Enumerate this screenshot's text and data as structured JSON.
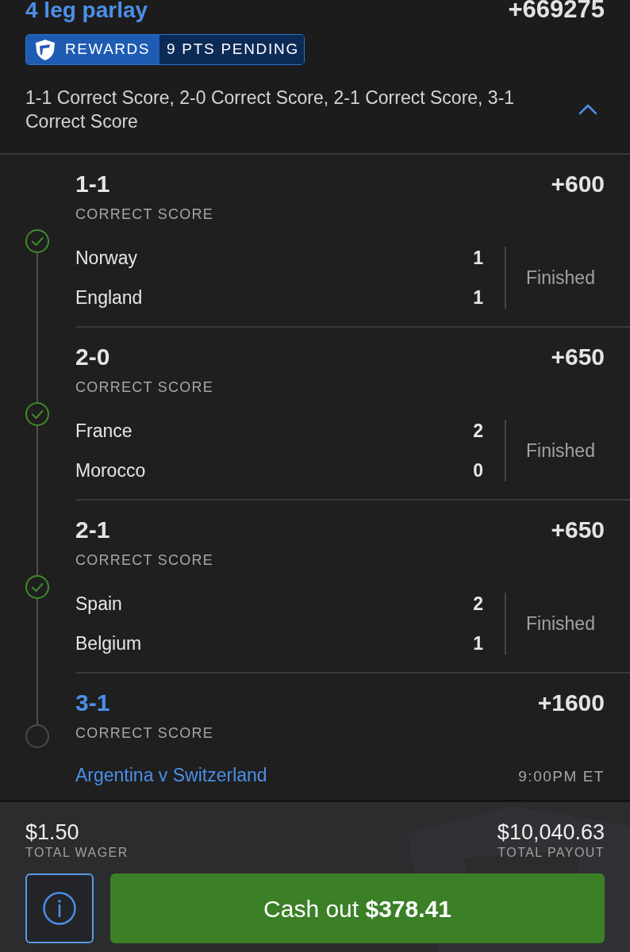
{
  "parlay": {
    "title": "4 leg parlay",
    "odds": "+669275",
    "rewards": {
      "label": "REWARDS",
      "points": "9 PTS PENDING"
    },
    "summary": "1-1 Correct Score, 2-0 Correct Score, 2-1 Correct Score, 3-1 Correct Score",
    "expanded": true
  },
  "legs": [
    {
      "kind": "settled",
      "won": true,
      "selection": "1-1",
      "market": "CORRECT SCORE",
      "odds": "+600",
      "teams": [
        {
          "name": "Norway",
          "score": "1"
        },
        {
          "name": "England",
          "score": "1"
        }
      ],
      "result": "Finished"
    },
    {
      "kind": "settled",
      "won": true,
      "selection": "2-0",
      "market": "CORRECT SCORE",
      "odds": "+650",
      "teams": [
        {
          "name": "France",
          "score": "2"
        },
        {
          "name": "Morocco",
          "score": "0"
        }
      ],
      "result": "Finished"
    },
    {
      "kind": "settled",
      "won": true,
      "selection": "2-1",
      "market": "CORRECT SCORE",
      "odds": "+650",
      "teams": [
        {
          "name": "Spain",
          "score": "2"
        },
        {
          "name": "Belgium",
          "score": "1"
        }
      ],
      "result": "Finished"
    },
    {
      "kind": "upcoming",
      "won": false,
      "selection": "3-1",
      "market": "CORRECT SCORE",
      "odds": "+1600",
      "event": "Argentina v Switzerland",
      "start_time": "9:00PM ET"
    }
  ],
  "footer": {
    "wager": {
      "amount": "$1.50",
      "label": "TOTAL WAGER"
    },
    "payout": {
      "amount": "$10,040.63",
      "label": "TOTAL PAYOUT"
    },
    "cash_out": "Cash out **$378.41**"
  }
}
